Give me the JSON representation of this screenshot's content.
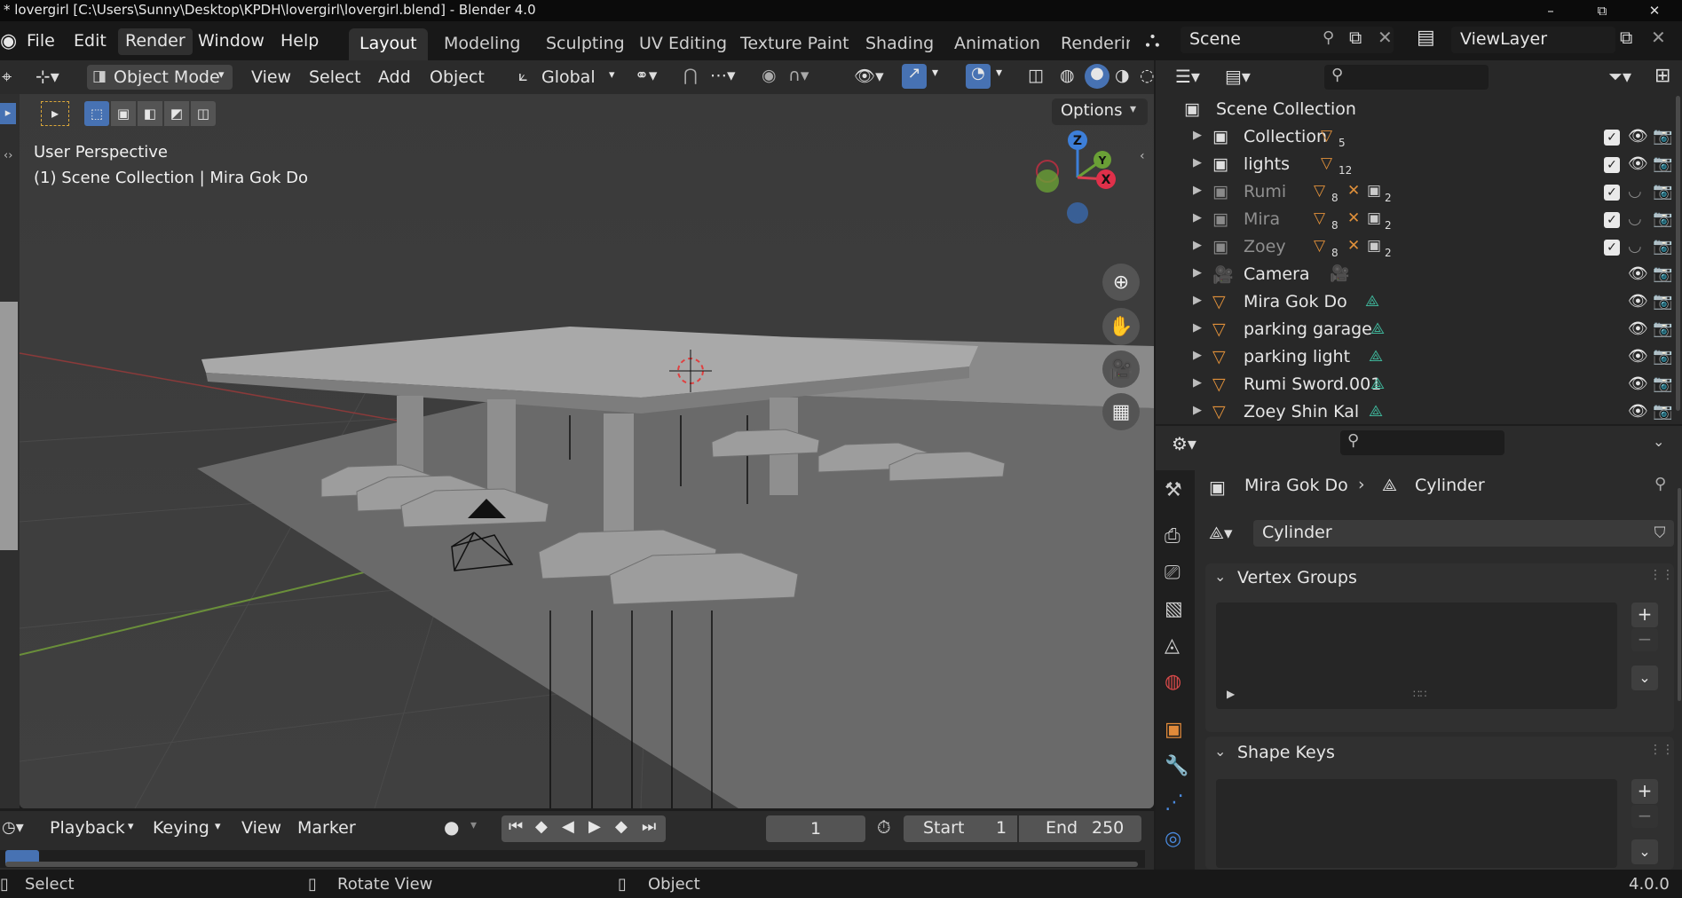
{
  "window": {
    "title": "* lovergirl [C:\\Users\\Sunny\\Desktop\\KPDH\\lovergirl\\lovergirl.blend] - Blender 4.0",
    "minimize": "–",
    "maximize": "⧉",
    "close": "✕"
  },
  "menu": [
    "File",
    "Edit",
    "Render",
    "Window",
    "Help"
  ],
  "workspaces": [
    "Layout",
    "Modeling",
    "Sculpting",
    "UV Editing",
    "Texture Paint",
    "Shading",
    "Animation",
    "Rendering"
  ],
  "scene": {
    "name": "Scene",
    "view_layer": "ViewLayer"
  },
  "viewport_header": {
    "mode": "Object Mode",
    "menus": [
      "View",
      "Select",
      "Add",
      "Object"
    ],
    "orientation": "Global",
    "options": "Options"
  },
  "viewport": {
    "perspective": "User Perspective",
    "info": "(1) Scene Collection | Mira Gok Do",
    "gizmo": {
      "z": "Z",
      "x": "X",
      "y": "Y"
    }
  },
  "outliner": {
    "root": "Scene Collection",
    "rows": [
      {
        "name": "Collection",
        "badge": "5",
        "dim": false,
        "checked": true
      },
      {
        "name": "lights",
        "badge": "12",
        "dim": false,
        "checked": true
      },
      {
        "name": "Rumi",
        "badge": "8",
        "badge2": "2",
        "dim": true,
        "checked": true
      },
      {
        "name": "Mira",
        "badge": "8",
        "badge2": "2",
        "dim": true,
        "checked": true
      },
      {
        "name": "Zoey",
        "badge": "8",
        "badge2": "2",
        "dim": true,
        "checked": true
      },
      {
        "name": "Camera",
        "dim": false,
        "checked": false
      },
      {
        "name": "Mira Gok Do",
        "dim": false,
        "checked": false
      },
      {
        "name": "parking garage",
        "dim": false,
        "checked": false
      },
      {
        "name": "parking light",
        "dim": false,
        "checked": false
      },
      {
        "name": "Rumi Sword.001",
        "dim": false,
        "checked": false
      },
      {
        "name": "Zoey Shin Kal",
        "dim": false,
        "checked": false
      }
    ]
  },
  "properties": {
    "breadcrumb_object": "Mira Gok Do",
    "breadcrumb_data": "Cylinder",
    "mesh_name": "Cylinder",
    "panels": [
      "Vertex Groups",
      "Shape Keys"
    ]
  },
  "timeline": {
    "menus": [
      "Playback",
      "Keying",
      "View",
      "Marker"
    ],
    "current_frame": "1",
    "start_label": "Start",
    "start": "1",
    "end_label": "End",
    "end": "250"
  },
  "status": {
    "select": "Select",
    "rotate": "Rotate View",
    "object": "Object",
    "version": "4.0.0"
  }
}
